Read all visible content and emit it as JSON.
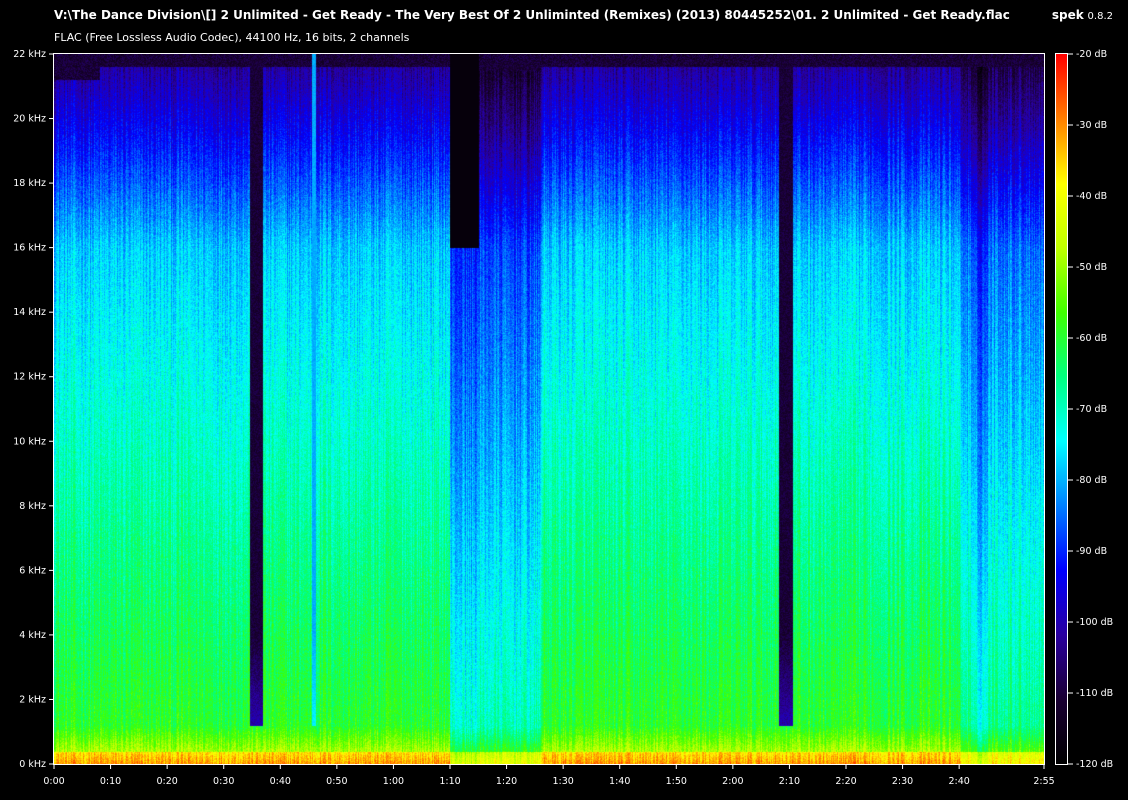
{
  "window": {
    "file_path": "V:\\The Dance Division\\[] 2 Unlimited - Get Ready - The Very Best Of 2 Unliminted (Remixes) (2013) 80445252\\01. 2 Unlimited - Get Ready.flac",
    "format_info": "FLAC (Free Lossless Audio Codec), 44100 Hz, 16 bits, 2 channels",
    "app_name": "spek",
    "app_version": "0.8.2"
  },
  "spectrogram": {
    "y_ticks": [
      "0 kHz",
      "2 kHz",
      "4 kHz",
      "6 kHz",
      "8 kHz",
      "10 kHz",
      "12 kHz",
      "14 kHz",
      "16 kHz",
      "18 kHz",
      "20 kHz",
      "22 kHz"
    ],
    "x_ticks": [
      "0:00",
      "0:10",
      "0:20",
      "0:30",
      "0:40",
      "0:50",
      "1:00",
      "1:10",
      "1:20",
      "1:30",
      "1:40",
      "1:50",
      "2:00",
      "2:10",
      "2:20",
      "2:30",
      "2:40",
      "2:55"
    ],
    "db_ticks": [
      "-20 dB",
      "-30 dB",
      "-40 dB",
      "-50 dB",
      "-60 dB",
      "-70 dB",
      "-80 dB",
      "-90 dB",
      "-100 dB",
      "-110 dB",
      "-120 dB"
    ],
    "duration_seconds": 175,
    "max_khz": 22,
    "palette": [
      "#000000",
      "#1a0033",
      "#2a00a0",
      "#0000ff",
      "#0080ff",
      "#00ffff",
      "#00ff80",
      "#40ff00",
      "#c0ff00",
      "#ffff00",
      "#ff8000",
      "#ff0000"
    ]
  }
}
